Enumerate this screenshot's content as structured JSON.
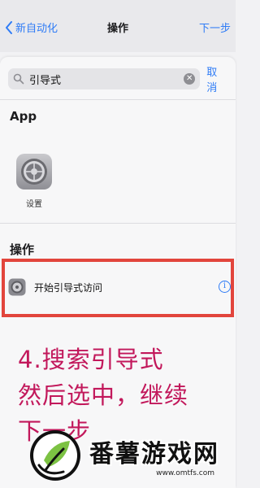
{
  "nav": {
    "back_label": "新自动化",
    "title": "操作",
    "next_label": "下一步"
  },
  "search": {
    "value": "引导式",
    "cancel_label": "取消"
  },
  "sections": {
    "app_title": "App",
    "actions_title": "操作"
  },
  "app_tile": {
    "label": "设置",
    "icon": "settings-gear-icon"
  },
  "action": {
    "label": "开始引导式访问",
    "icon": "settings-gear-icon",
    "info_icon": "info-icon"
  },
  "caption": {
    "line1": "4.搜索引导式",
    "line2": "然后选中，继续",
    "line3": "下一步"
  },
  "watermark": {
    "name": "番薯游戏网",
    "url": "www.omtfs.com"
  },
  "colors": {
    "accent": "#2f7cf6",
    "highlight_border": "#e2453c",
    "caption": "#c2185b"
  }
}
